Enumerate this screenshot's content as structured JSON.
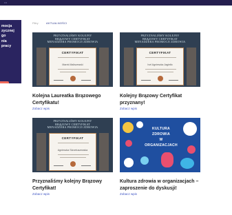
{
  "promo": {
    "text": "mocja\nzycznej\ngo\nnia\n pracy",
    "cta": "T"
  },
  "filters": {
    "all": "Filtry",
    "current": "AKTUALNOŚCI"
  },
  "cards": [
    {
      "header": "PRZYZNALIŚMY KOLEJNY\nBRĄZOWY CERTYFIKAT\nMENADŻERA PROMOCJI ZDROWIA",
      "cert_title": "CERTYFIKAT",
      "cert_name": "Marek Maliszewski",
      "title": "Kolejna Laureatka Brązowego Certyfikatu!",
      "more": "Zobacz wpis"
    },
    {
      "header": "PRZYZNALIŚMY KOLEJNY\nBRĄZOWY CERTYFIKAT\nMENADŻERA PROMOCJI ZDROWIA",
      "cert_title": "CERTYFIKAT",
      "cert_name": "Ivel Agnieszka Jagiełło",
      "title": "Kolejny Brązowy Certyfikat przyznany!",
      "more": "Zobacz wpis"
    },
    {
      "header": "PRZYZNALIŚMY KOLEJNY\nBRĄZOWY CERTYFIKAT\nMENADŻERA PROMOCJI ZDROWIA",
      "cert_title": "CERTYFIKAT",
      "cert_name": "Agnieszka Skrzetuszewska",
      "title": "Przyznaliśmy kolejny Brązowy Certyfikat!",
      "more": "Zobacz wpis"
    },
    {
      "header": "KULTURA\nZDROWIA\nW ORGANIZACJACH",
      "title": "Kultura zdrowia w organizacjach – zaproszenie do dyskusji!",
      "more": "Zobacz wpis"
    }
  ],
  "colors": {
    "navy": "#2a2460",
    "link": "#3f55c4",
    "accent": "#f06a5a",
    "cert_bg": "#2f3f52",
    "health_bg": "#1f4fa0"
  }
}
